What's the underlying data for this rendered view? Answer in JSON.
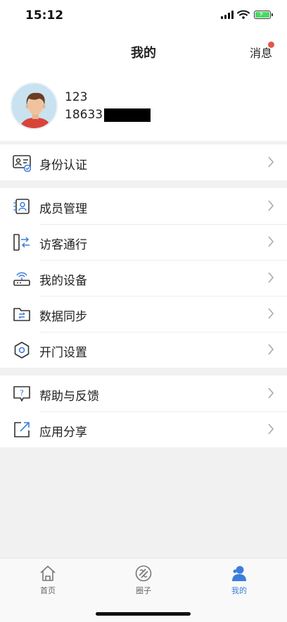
{
  "status_bar": {
    "time": "15:12"
  },
  "nav": {
    "title": "我的",
    "message_label": "消息"
  },
  "profile": {
    "name": "123",
    "phone": "18633"
  },
  "menu_groups": [
    [
      {
        "label": "身份认证",
        "icon": "id-card-verified-icon"
      }
    ],
    [
      {
        "label": "成员管理",
        "icon": "member-card-icon"
      },
      {
        "label": "访客通行",
        "icon": "visitor-pass-icon"
      },
      {
        "label": "我的设备",
        "icon": "router-device-icon"
      },
      {
        "label": "数据同步",
        "icon": "folder-sync-icon"
      },
      {
        "label": "开门设置",
        "icon": "hexagon-settings-icon"
      }
    ],
    [
      {
        "label": "帮助与反馈",
        "icon": "help-bubble-icon"
      },
      {
        "label": "应用分享",
        "icon": "share-arrow-icon"
      }
    ]
  ],
  "tabbar": {
    "home": "首页",
    "circle": "圈子",
    "mine": "我的",
    "active": "mine"
  },
  "colors": {
    "accent": "#3b7ddd",
    "badge": "#e4564b",
    "battery": "#4cd964"
  }
}
